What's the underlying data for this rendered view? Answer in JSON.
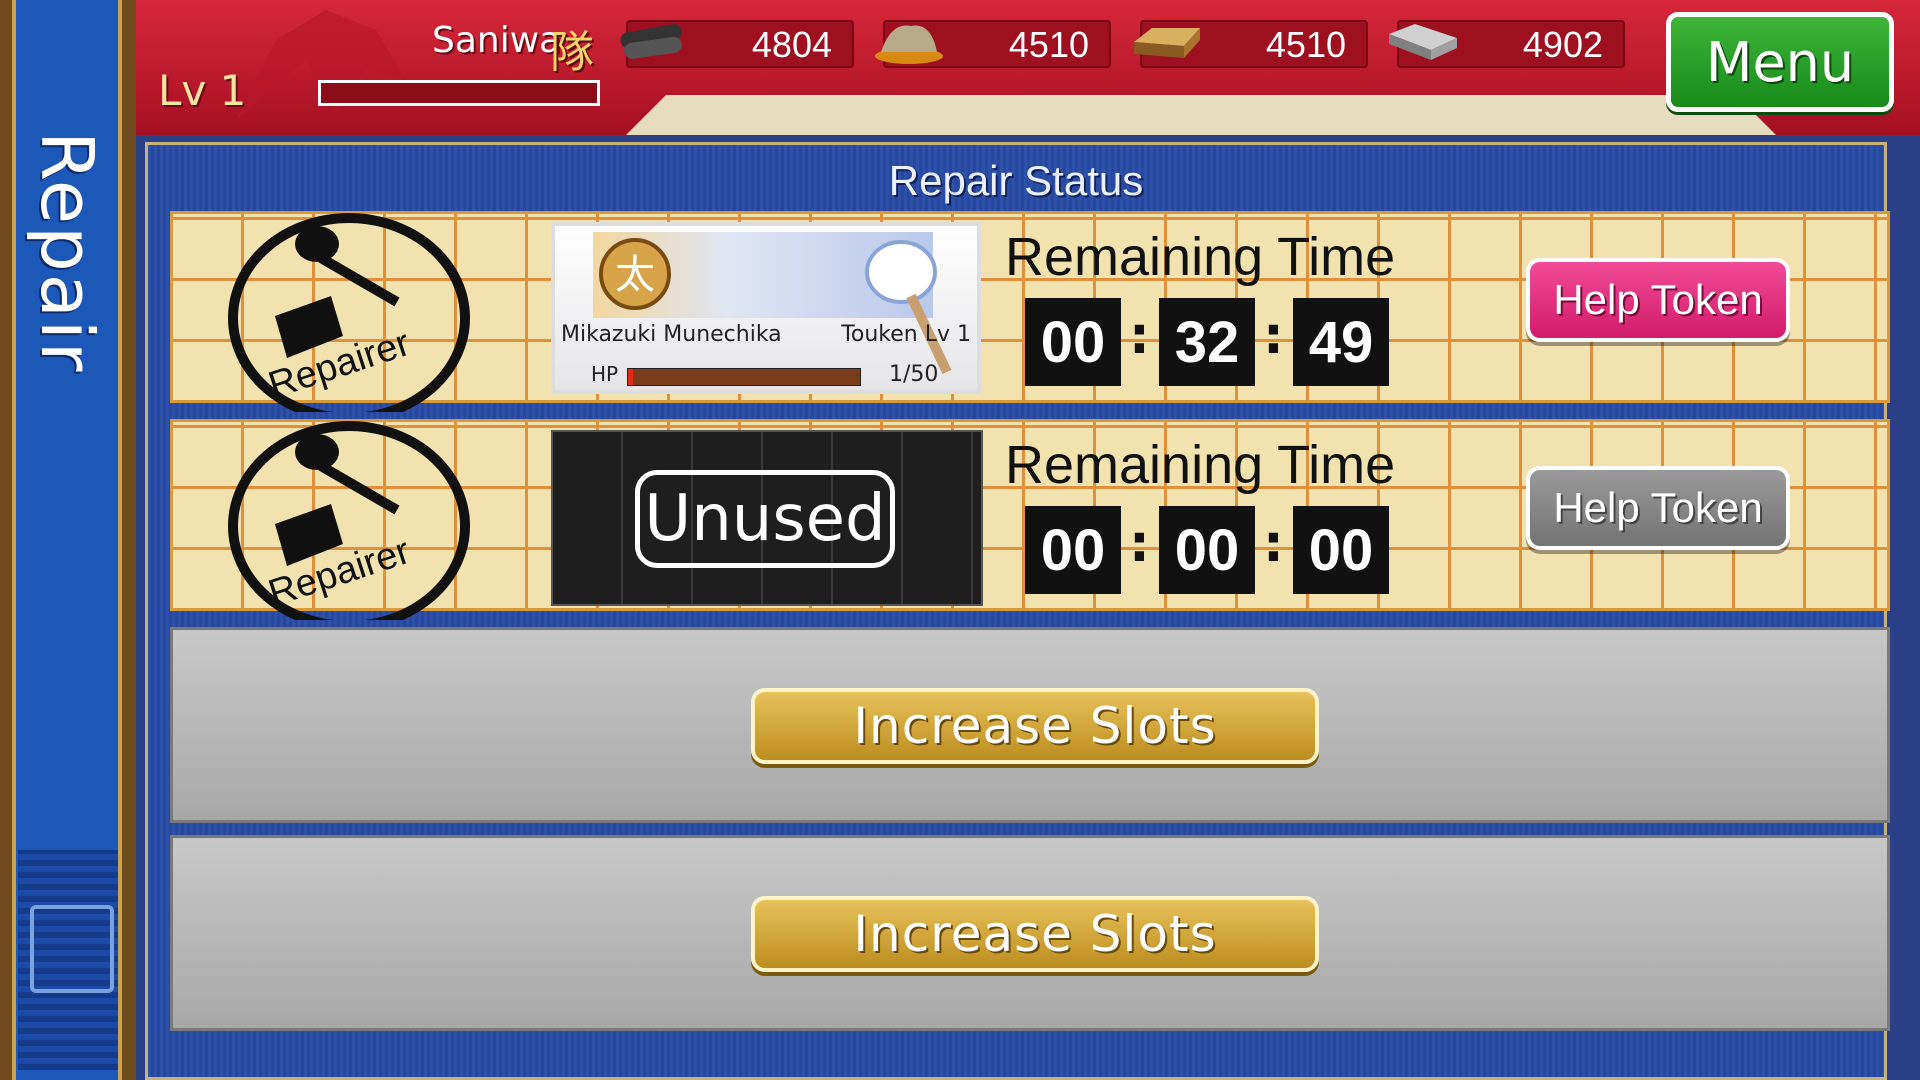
{
  "side_tab": {
    "title": "Repair"
  },
  "header": {
    "player_name": "Saniwa",
    "player_kanji": "隊",
    "level": "Lv 1",
    "exp_fraction": 0.0,
    "resources": [
      {
        "icon": "charcoal-icon",
        "value": "4804"
      },
      {
        "icon": "steel-icon",
        "value": "4510"
      },
      {
        "icon": "cooling-material-icon",
        "value": "4510"
      },
      {
        "icon": "whetstone-icon",
        "value": "4902"
      }
    ],
    "menu_label": "Menu"
  },
  "panel": {
    "title": "Repair Status",
    "slots": [
      {
        "repairer_label": "Repairer",
        "sword_name": "Mikazuki Munechika",
        "sword_level_label": "Touken Lv",
        "sword_level": "1",
        "hp_label": "HP",
        "hp_value": "1/50",
        "hp_fraction": 0.02,
        "remaining_label": "Remaining Time",
        "time": [
          "00",
          "32",
          "49"
        ],
        "help_label": "Help Token"
      },
      {
        "repairer_label": "Repairer",
        "status": "Unused",
        "remaining_label": "Remaining Time",
        "time": [
          "00",
          "00",
          "00"
        ],
        "help_label": "Help Token"
      }
    ],
    "increase_label": "Increase Slots"
  },
  "colors": {
    "header_red": "#c41a2e",
    "panel_blue": "#2e51a8",
    "help_active": "#e0307f",
    "menu_green": "#2a9e2a"
  }
}
